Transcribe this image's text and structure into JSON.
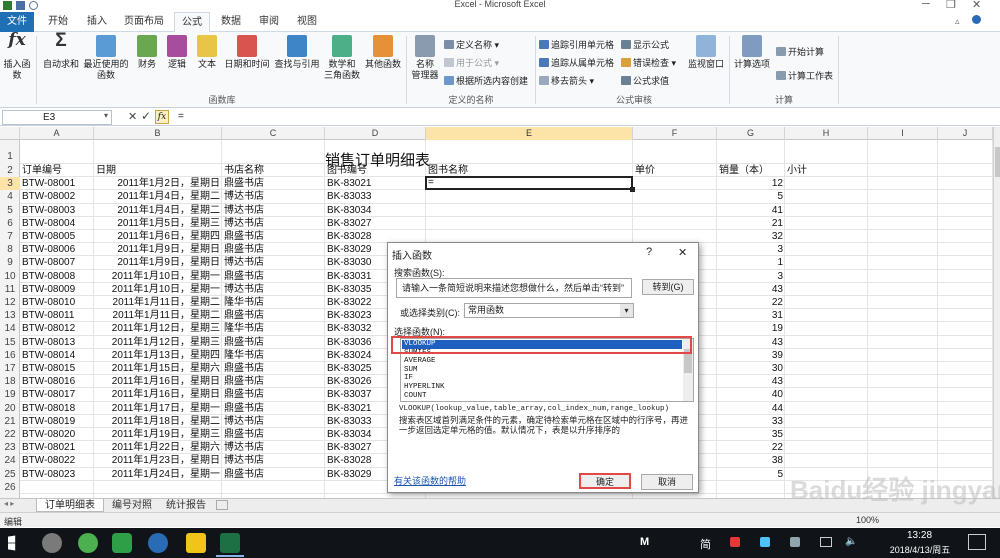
{
  "window": {
    "title": "Excel  -  Microsoft Excel"
  },
  "tabs": [
    "文件",
    "开始",
    "插入",
    "页面布局",
    "公式",
    "数据",
    "审阅",
    "视图"
  ],
  "ribbon": {
    "insert_function": "插入函数",
    "autosum": "自动求和",
    "recent1": "最近使用的",
    "recent2": "函数",
    "finance": "财务",
    "logic": "逻辑",
    "text": "文本",
    "datetime": "日期和时间",
    "lookup": "查找与引用",
    "math1": "数学和",
    "math2": "三角函数",
    "other": "其他函数",
    "name_mgr1": "名称",
    "name_mgr2": "管理器",
    "define_name": "定义名称",
    "use_in_formula": "用于公式",
    "create_from_sel": "根据所选内容创建",
    "trace_prec": "追踪引用单元格",
    "trace_dep": "追踪从属单元格",
    "remove_arrows": "移去箭头",
    "show_formulas": "显示公式",
    "error_check": "错误检查",
    "eval_formula": "公式求值",
    "watch": "监视窗口",
    "calc_options": "计算选项",
    "calc_now": "开始计算",
    "calc_sheet": "计算工作表",
    "group_funclib": "函数库",
    "group_names": "定义的名称",
    "group_audit": "公式审核",
    "group_calc": "计算"
  },
  "formula_bar": {
    "name_box": "E3",
    "fx": "fx",
    "content": "="
  },
  "columns": [
    "A",
    "B",
    "C",
    "D",
    "E",
    "F",
    "G",
    "H",
    "I",
    "J"
  ],
  "sheet": {
    "title": "销售订单明细表",
    "headers": [
      "订单编号",
      "日期",
      "书店名称",
      "图书编号",
      "图书名称",
      "单价",
      "销量（本）",
      "小计"
    ],
    "rows": [
      [
        "BTW-08001",
        "2011年1月2日，星期日",
        "鼎盛书店",
        "BK-83021",
        "12"
      ],
      [
        "BTW-08002",
        "2011年1月4日，星期二",
        "博达书店",
        "BK-83033",
        "5"
      ],
      [
        "BTW-08003",
        "2011年1月4日，星期二",
        "博达书店",
        "BK-83034",
        "41"
      ],
      [
        "BTW-08004",
        "2011年1月5日，星期三",
        "博达书店",
        "BK-83027",
        "21"
      ],
      [
        "BTW-08005",
        "2011年1月6日，星期四",
        "鼎盛书店",
        "BK-83028",
        "32"
      ],
      [
        "BTW-08006",
        "2011年1月9日，星期日",
        "鼎盛书店",
        "BK-83029",
        "3"
      ],
      [
        "BTW-08007",
        "2011年1月9日，星期日",
        "博达书店",
        "BK-83030",
        "1"
      ],
      [
        "BTW-08008",
        "2011年1月10日，星期一",
        "鼎盛书店",
        "BK-83031",
        "3"
      ],
      [
        "BTW-08009",
        "2011年1月10日，星期一",
        "博达书店",
        "BK-83035",
        "43"
      ],
      [
        "BTW-08010",
        "2011年1月11日，星期二",
        "隆华书店",
        "BK-83022",
        "22"
      ],
      [
        "BTW-08011",
        "2011年1月11日，星期二",
        "鼎盛书店",
        "BK-83023",
        "31"
      ],
      [
        "BTW-08012",
        "2011年1月12日，星期三",
        "隆华书店",
        "BK-83032",
        "19"
      ],
      [
        "BTW-08013",
        "2011年1月12日，星期三",
        "鼎盛书店",
        "BK-83036",
        "43"
      ],
      [
        "BTW-08014",
        "2011年1月13日，星期四",
        "隆华书店",
        "BK-83024",
        "39"
      ],
      [
        "BTW-08015",
        "2011年1月15日，星期六",
        "鼎盛书店",
        "BK-83025",
        "30"
      ],
      [
        "BTW-08016",
        "2011年1月16日，星期日",
        "鼎盛书店",
        "BK-83026",
        "43"
      ],
      [
        "BTW-08017",
        "2011年1月16日，星期日",
        "鼎盛书店",
        "BK-83037",
        "40"
      ],
      [
        "BTW-08018",
        "2011年1月17日，星期一",
        "鼎盛书店",
        "BK-83021",
        "44"
      ],
      [
        "BTW-08019",
        "2011年1月18日，星期二",
        "博达书店",
        "BK-83033",
        "33"
      ],
      [
        "BTW-08020",
        "2011年1月19日，星期三",
        "鼎盛书店",
        "BK-83034",
        "35"
      ],
      [
        "BTW-08021",
        "2011年1月22日，星期六",
        "博达书店",
        "BK-83027",
        "22"
      ],
      [
        "BTW-08022",
        "2011年1月23日，星期日",
        "博达书店",
        "BK-83028",
        "38"
      ],
      [
        "BTW-08023",
        "2011年1月24日，星期一",
        "鼎盛书店",
        "BK-83029",
        "5"
      ]
    ],
    "active_cell_value": "="
  },
  "dialog": {
    "title": "插入函数",
    "help_q": "?",
    "close": "✕",
    "search_label": "搜索函数(S):",
    "search_text": "请输入一条简短说明来描述您想做什么，然后单击“转到”",
    "go": "转到(G)",
    "category_label": "或选择类别(C):",
    "category_value": "常用函数",
    "select_label": "选择函数(N):",
    "functions": [
      "VLOOKUP",
      "SUMIFS",
      "AVERAGE",
      "SUM",
      "IF",
      "HYPERLINK",
      "COUNT"
    ],
    "signature": "VLOOKUP(lookup_value,table_array,col_index_num,range_lookup)",
    "description": "搜索表区域首列满足条件的元素，确定待检索单元格在区域中的行序号，再进一步返回选定单元格的值。默认情况下，表是以升序排序的",
    "help_link": "有关该函数的帮助",
    "ok": "确定",
    "cancel": "取消"
  },
  "sheet_tabs": [
    "订单明细表",
    "编号对照",
    "统计报告"
  ],
  "status": {
    "mode": "编辑",
    "zoom": "100%"
  },
  "taskbar": {
    "time": "13:28",
    "date": "2018/4/13/周五",
    "ime": "简"
  },
  "watermark": "Baidu经验 jingyan.baidu.com"
}
